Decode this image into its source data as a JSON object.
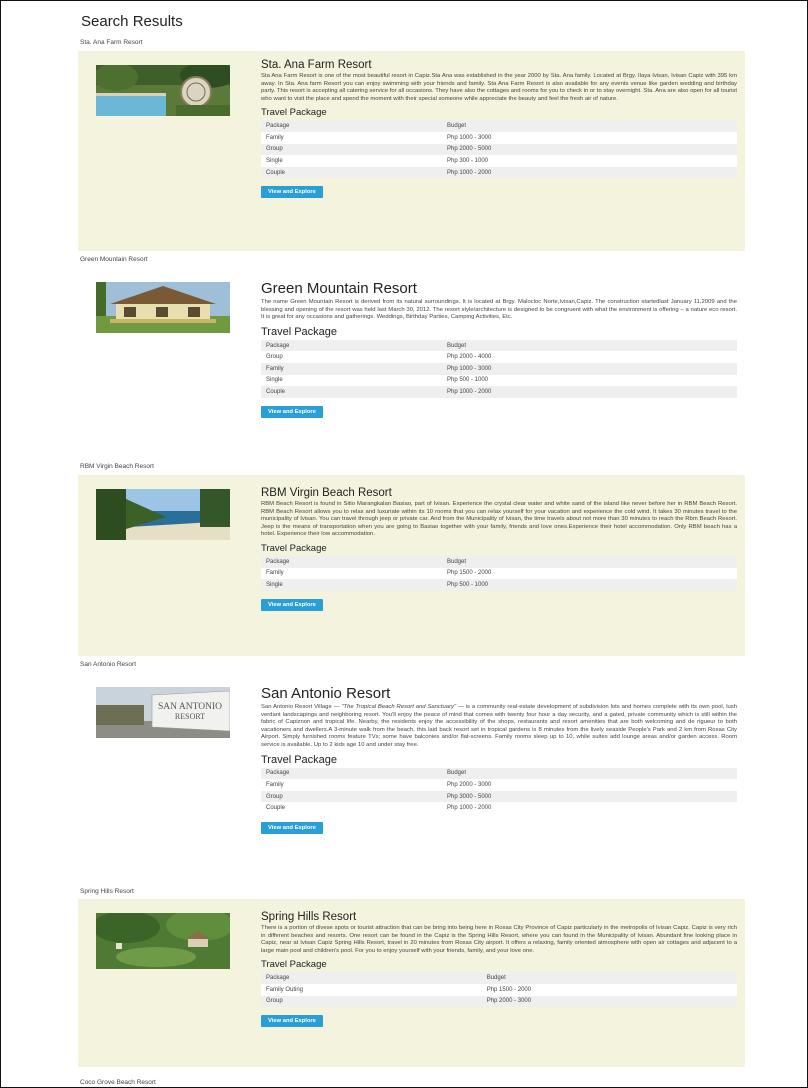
{
  "page": {
    "title": "Search Results"
  },
  "button_label": "View and Explore",
  "package_heading": "Travel Package",
  "table_headers": [
    "Package",
    "Budget"
  ],
  "resorts": [
    {
      "label": "Sta. Ana Farm Resort",
      "title": "Sta. Ana Farm Resort",
      "description": "Sta Ana Farm Resort is one of the most beautiful resort in Capiz.Sta Ana was established in the year 2000 by Sta. Ana family. Located at Brgy. Ilaya Ivisan, Ivisan Capiz with 395 km away. In Sta. Ana farm Resort you can enjoy swimming with your friends and family. Sta Ana Farm Resort is also available for any events venue like garden wedding and birthday party. This resort is accepting all catering service for all occasions. They have also the cottages and rooms for you to check in or to stay overnight. Sta. Ana are also open for all tourist who want to visit the place and spend the moment with their special someone while appreciate the beauty and feel the fresh air of nature.",
      "packages": [
        [
          "Family",
          "Php 1000 - 3000"
        ],
        [
          "Group",
          "Php 2000 - 5000"
        ],
        [
          "Single",
          "Php 300 - 1000"
        ],
        [
          "Couple",
          "Php 1000 - 2000"
        ]
      ]
    },
    {
      "label": "Green Mountain Resort",
      "title": "Green Mountain Resort",
      "description": "The name Green Mountain Resort is derived from its natural surroundings. It is located at Brgy. Malocloc Norte,Ivisan,Capiz. The construction startedlast January 11,2009 and the blessing and opening of the resort was held last March 30, 2012. The resort style/architecture is designed to be congruent with what the environment is offering – a nature eco resort. It is great for any occasions and gatherings. Weddings, Birthday Parties, Camping Activities, Etc.",
      "packages": [
        [
          "Group",
          "Php 2000 - 4000"
        ],
        [
          "Family",
          "Php 1000 - 3000"
        ],
        [
          "Single",
          "Php 500 - 1000"
        ],
        [
          "Couple",
          "Php 1000 - 2000"
        ]
      ]
    },
    {
      "label": "RBM Virgin Beach Resort",
      "title": "RBM Virgin Beach Resort",
      "description": "RBM Beach Resort is found in Sitio Marangkalan Basiao, part of Ivisan. Experience the crystal clear water and white sand of the island like never before her in RBM Beach Resort. RBM Beach Resort allows you to relax and luxuriate within its 10 rooms that you can relax yourself for your vacation and experience the cold wind. It takes 30 minutes travel to the municipality of Ivisan. You can travel through jeep or private car. And from the Municipality of Ivisan, the time travels about not more than 30 minutes to reach the Rbm Beach Resort. Jeep is the means of transportation when you are going to Basiao together with your family, friends and love ones.Experience their hotel accommodation. Only RBM beach has a hotel. Experience their low accommodation.",
      "packages": [
        [
          "Family",
          "Php 1500 - 2000"
        ],
        [
          "Single",
          "Php 500 - 1000"
        ]
      ]
    },
    {
      "label": "San Antonio Resort",
      "title": "San Antonio Resort",
      "desc_before": "San Antonio Resort Village — ",
      "desc_quote": "\"The Tropical Beach Resort and Sanctuary\"",
      "desc_after": " — is a community real-estate development of subdivision lots and homes complete with its own pool, lush verdant landscapings and neighboring resort. You'll enjoy the peace of mind that comes with twenty four hour a day security, and a gated, private community which is still within the fabric of Capiznon and tropical life. Nearby, the residents enjoy the accessibility of the shops, restaurants and resort amenities that are both welcoming and de rigueur to both vacationers and dwellers.A 3-minute walk from the beach, this laid back resort set in tropical gardens is 8 minutes from the lively seaside People's Park and 2 km from Roxas City Airport. Simply furnished rooms feature TVs; some have balconies and/or flat-screens. Family rooms sleep up to 10, while suites add lounge areas and/or garden access. Room service is available. Up to 2 kids age 10 and under stay free.",
      "packages": [
        [
          "Family",
          "Php 2000 - 3000"
        ],
        [
          "Group",
          "Php 3000 - 5000"
        ],
        [
          "Couple",
          "Php 1000 - 2000"
        ]
      ]
    },
    {
      "label": "Spring Hills Resort",
      "title": "Spring Hills Resort",
      "description": "There is a portion of divese spots or tourist attraction that can be bring into being here in Roxas City Province of Capiz particularly in the metropolis of Ivisan Capiz. Capiz is very rich in different beaches and resorts. One resort can be found in the Capiz is the Spring Hills Resort, where you can found in the Municipality of Ivisan. Abundant fine looking place in Capiz, near at Ivisan Capiz Spring Hills Resort, travel in 20 minutes from Roxas City airport. It offers a relaxing, family oriented atmosphere with open air cottages and adjacent to a large main pool and children's pool. For you to enjoy yourself with your friends, family, and your love one.",
      "packages": [
        [
          "Family Outing",
          "Php 1500 - 2000"
        ],
        [
          "Group",
          "Php 2000 - 3000"
        ]
      ]
    },
    {
      "label": "Coco Grove Beach Resort"
    }
  ],
  "sign_text": [
    "SAN ANTONIO",
    "RESORT"
  ],
  "colors": {
    "card_bg": "#f4f3dd",
    "button": "#2a9fd6",
    "row_alt": "#efefef"
  }
}
